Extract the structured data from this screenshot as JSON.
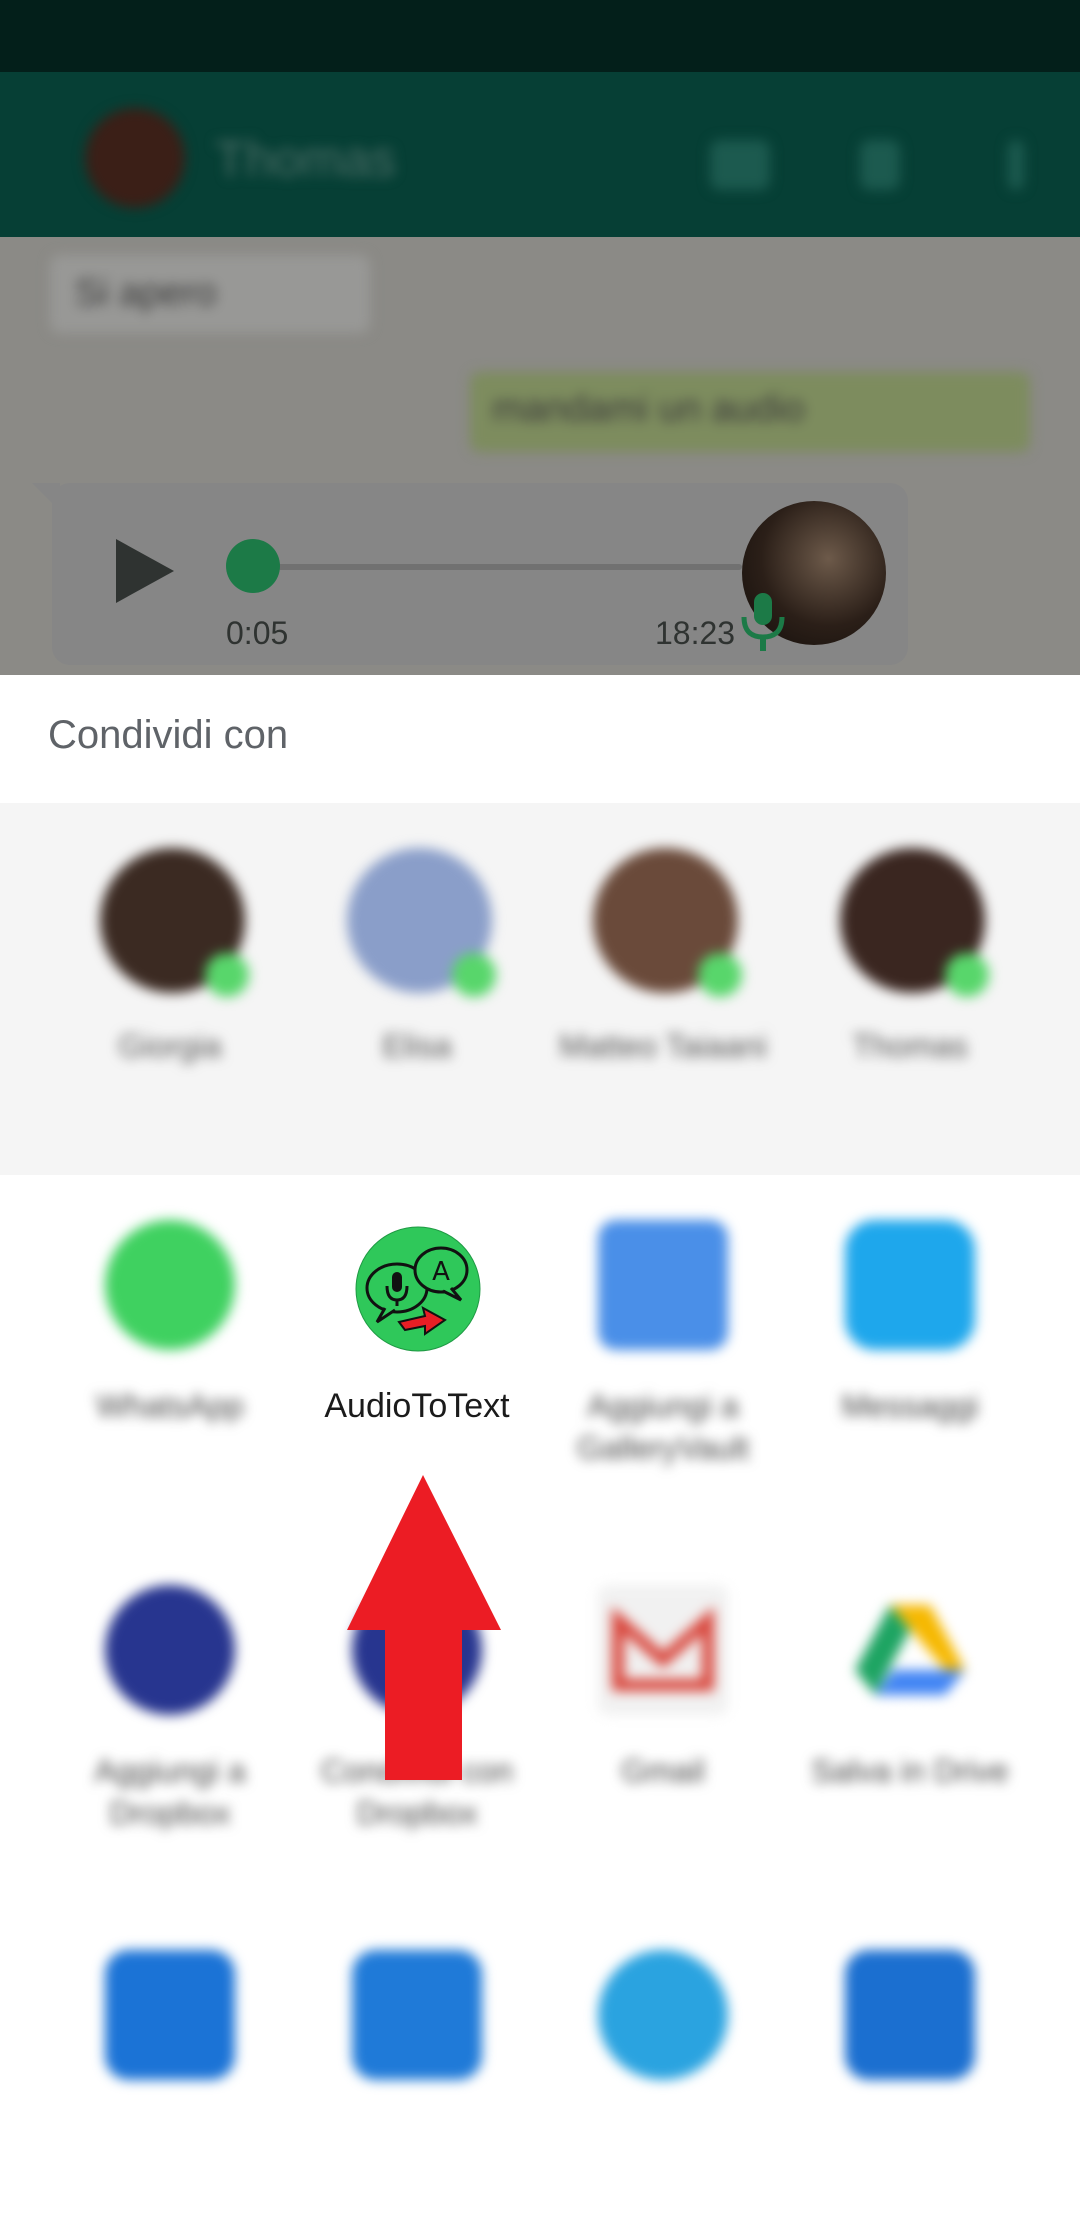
{
  "chat": {
    "contact_name": "Thomas",
    "incoming_message": "Si apero",
    "outgoing_message": "mandami un audio"
  },
  "audio_player": {
    "elapsed": "0:05",
    "timestamp": "18:23",
    "progress": 0.0
  },
  "share_sheet": {
    "title": "Condividi con",
    "contacts": [
      {
        "name": "Giorgia",
        "avatar_color": "#3b2a22"
      },
      {
        "name": "Elisa",
        "avatar_color": "#8a9ec9"
      },
      {
        "name": "Matteo Taiaani",
        "avatar_color": "#6a4a3a"
      },
      {
        "name": "Thomas",
        "avatar_color": "#3a2620"
      }
    ],
    "apps_row1": [
      {
        "label": "WhatsApp",
        "icon": "whatsapp-icon",
        "color": "#3fd160"
      },
      {
        "label": "AudioToText",
        "icon": "audiototext-icon",
        "color": "#2fc85a"
      },
      {
        "label": "Aggiungi a GalleryVault",
        "icon": "gallery-icon",
        "color": "#4a8fe8"
      },
      {
        "label": "Messaggi",
        "icon": "messages-icon",
        "color": "#1ea7ec"
      }
    ],
    "apps_row2": [
      {
        "label": "Aggiungi a Dropbox",
        "icon": "dropbox-icon",
        "color": "#27358f"
      },
      {
        "label": "Condividi con Dropbox",
        "icon": "dropbox-share-icon",
        "color": "#27358f"
      },
      {
        "label": "Gmail",
        "icon": "gmail-icon",
        "color": "#e9e9e9"
      },
      {
        "label": "Salva in Drive",
        "icon": "drive-icon",
        "color": "#ffffff"
      }
    ],
    "apps_row3_colors": [
      "#1b73d6",
      "#1f7ad8",
      "#2aa3e0",
      "#1b6fd0"
    ]
  },
  "colors": {
    "arrow": "#ec1c24",
    "whatsapp_header": "#063f35"
  }
}
